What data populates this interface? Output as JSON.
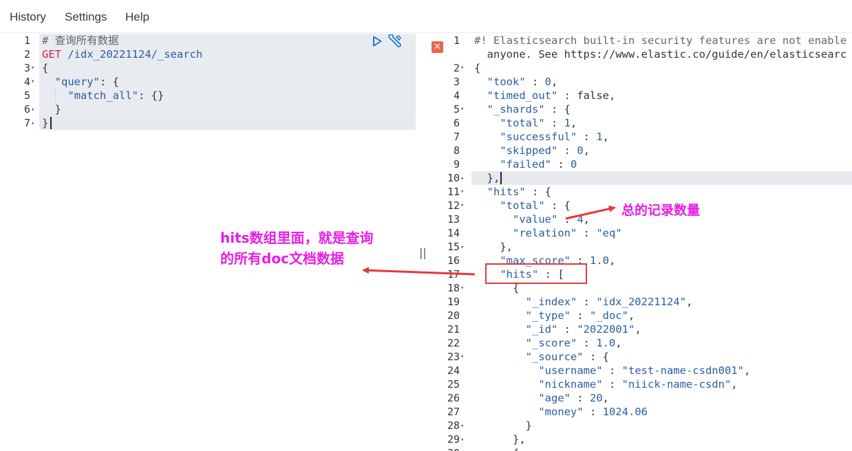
{
  "menu": {
    "history": "History",
    "settings": "Settings",
    "help": "Help"
  },
  "request": {
    "lines": [
      {
        "num": "1",
        "fold": "",
        "text": "# 查询所有数据"
      },
      {
        "num": "2",
        "fold": "",
        "text": "GET /idx_20221124/_search"
      },
      {
        "num": "3",
        "fold": "▾",
        "text": "{"
      },
      {
        "num": "4",
        "fold": "▾",
        "text": "  \"query\": {"
      },
      {
        "num": "5",
        "fold": "",
        "text": "    \"match_all\": {}"
      },
      {
        "num": "6",
        "fold": "▴",
        "text": "  }"
      },
      {
        "num": "7",
        "fold": "▴",
        "text": "}"
      }
    ]
  },
  "response": {
    "lines": [
      {
        "num": "1",
        "fold": "",
        "text": "#! Elasticsearch built-in security features are not enable"
      },
      {
        "num": "",
        "fold": "",
        "text": "  anyone. See https://www.elastic.co/guide/en/elasticsearc"
      },
      {
        "num": "2",
        "fold": "▾",
        "text": "{"
      },
      {
        "num": "3",
        "fold": "",
        "text": "  \"took\" : 0,"
      },
      {
        "num": "4",
        "fold": "",
        "text": "  \"timed_out\" : false,"
      },
      {
        "num": "5",
        "fold": "▾",
        "text": "  \"_shards\" : {"
      },
      {
        "num": "6",
        "fold": "",
        "text": "    \"total\" : 1,"
      },
      {
        "num": "7",
        "fold": "",
        "text": "    \"successful\" : 1,"
      },
      {
        "num": "8",
        "fold": "",
        "text": "    \"skipped\" : 0,"
      },
      {
        "num": "9",
        "fold": "",
        "text": "    \"failed\" : 0"
      },
      {
        "num": "10",
        "fold": "▴",
        "text": "  },"
      },
      {
        "num": "11",
        "fold": "▾",
        "text": "  \"hits\" : {"
      },
      {
        "num": "12",
        "fold": "▾",
        "text": "    \"total\" : {"
      },
      {
        "num": "13",
        "fold": "",
        "text": "      \"value\" : 4,"
      },
      {
        "num": "14",
        "fold": "",
        "text": "      \"relation\" : \"eq\""
      },
      {
        "num": "15",
        "fold": "▴",
        "text": "    },"
      },
      {
        "num": "16",
        "fold": "",
        "text": "    \"max_score\" : 1.0,"
      },
      {
        "num": "17",
        "fold": "▾",
        "text": "    \"hits\" : ["
      },
      {
        "num": "18",
        "fold": "▾",
        "text": "      {"
      },
      {
        "num": "19",
        "fold": "",
        "text": "        \"_index\" : \"idx_20221124\","
      },
      {
        "num": "20",
        "fold": "",
        "text": "        \"_type\" : \"_doc\","
      },
      {
        "num": "21",
        "fold": "",
        "text": "        \"_id\" : \"2022001\","
      },
      {
        "num": "22",
        "fold": "",
        "text": "        \"_score\" : 1.0,"
      },
      {
        "num": "23",
        "fold": "▾",
        "text": "        \"_source\" : {"
      },
      {
        "num": "24",
        "fold": "",
        "text": "          \"username\" : \"test-name-csdn001\","
      },
      {
        "num": "25",
        "fold": "",
        "text": "          \"nickname\" : \"niick-name-csdn\","
      },
      {
        "num": "26",
        "fold": "",
        "text": "          \"age\" : 20,"
      },
      {
        "num": "27",
        "fold": "",
        "text": "          \"money\" : 1024.06"
      },
      {
        "num": "28",
        "fold": "▴",
        "text": "        }"
      },
      {
        "num": "29",
        "fold": "▴",
        "text": "      },"
      },
      {
        "num": "30",
        "fold": "",
        "text": "      {"
      }
    ]
  },
  "annotations": {
    "total_note": "总的记录数量",
    "hits_note_line1": "hits数组里面，就是查询",
    "hits_note_line2": "的所有doc文档数据"
  },
  "divider_handle": "||",
  "error_glyph": "✕",
  "colors": {
    "annotation_text": "#e61ee6",
    "annotation_arrow": "#e8363a",
    "method": "#c7254e",
    "json_string": "#2b5c9f"
  }
}
